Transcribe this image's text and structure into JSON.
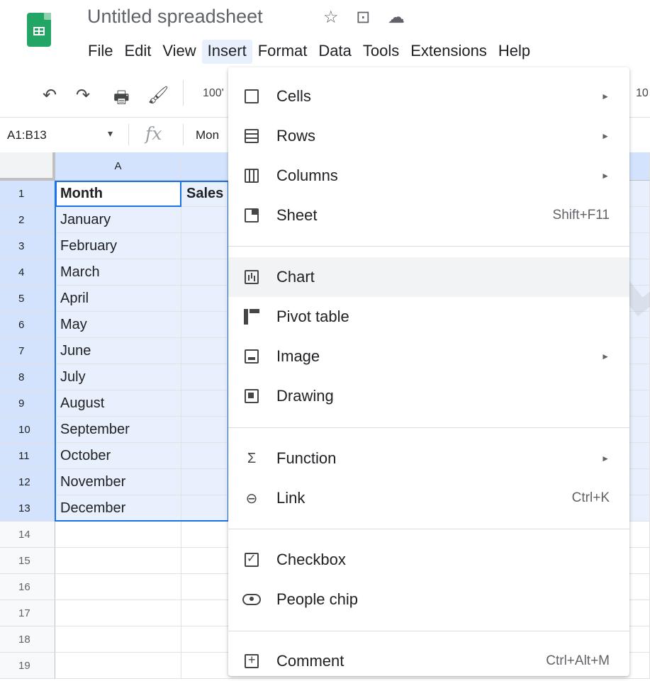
{
  "app": {
    "title": "Untitled spreadsheet",
    "title_icons": [
      "☆",
      "⊡",
      "☁"
    ]
  },
  "menubar": [
    "File",
    "Edit",
    "View",
    "Insert",
    "Format",
    "Data",
    "Tools",
    "Extensions",
    "Help"
  ],
  "toolbar": {
    "zoom": "100'",
    "zoom_right": "10",
    "icons": [
      "undo-icon",
      "redo-icon",
      "print-icon",
      "paint-format-icon"
    ]
  },
  "formula_bar": {
    "namebox": "A1:B13",
    "fx": "fx",
    "value": "Mon"
  },
  "sheet": {
    "col_a_header": "A",
    "rows": [
      {
        "n": "1",
        "a": "Month",
        "b": "Sales"
      },
      {
        "n": "2",
        "a": "January",
        "b": ""
      },
      {
        "n": "3",
        "a": "February",
        "b": ""
      },
      {
        "n": "4",
        "a": "March",
        "b": ""
      },
      {
        "n": "5",
        "a": "April",
        "b": ""
      },
      {
        "n": "6",
        "a": "May",
        "b": ""
      },
      {
        "n": "7",
        "a": "June",
        "b": ""
      },
      {
        "n": "8",
        "a": "July",
        "b": ""
      },
      {
        "n": "9",
        "a": "August",
        "b": ""
      },
      {
        "n": "10",
        "a": "September",
        "b": ""
      },
      {
        "n": "11",
        "a": "October",
        "b": ""
      },
      {
        "n": "12",
        "a": "November",
        "b": ""
      },
      {
        "n": "13",
        "a": "December",
        "b": ""
      },
      {
        "n": "14",
        "a": "",
        "b": ""
      },
      {
        "n": "15",
        "a": "",
        "b": ""
      },
      {
        "n": "16",
        "a": "",
        "b": ""
      },
      {
        "n": "17",
        "a": "",
        "b": ""
      },
      {
        "n": "18",
        "a": "",
        "b": ""
      },
      {
        "n": "19",
        "a": "",
        "b": ""
      }
    ]
  },
  "insert_menu": {
    "cells": "Cells",
    "rows": "Rows",
    "columns": "Columns",
    "sheet": "Sheet",
    "sheet_shortcut": "Shift+F11",
    "chart": "Chart",
    "pivot_table": "Pivot table",
    "image": "Image",
    "drawing": "Drawing",
    "function": "Function",
    "link": "Link",
    "link_shortcut": "Ctrl+K",
    "checkbox": "Checkbox",
    "people_chip": "People chip",
    "comment": "Comment",
    "comment_shortcut": "Ctrl+Alt+M",
    "submenu_arrow": "►"
  },
  "watermark": "CHOLOGY"
}
